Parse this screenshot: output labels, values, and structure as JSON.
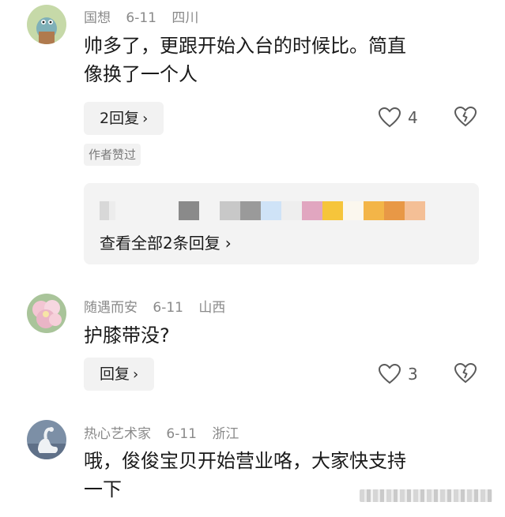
{
  "comments": [
    {
      "user": "国想",
      "date": "6-11",
      "location": "四川",
      "text_line1": "帅多了，更跟开始入台的时候比。简直",
      "text_line2": "像换了一个人",
      "reply_label": "2回复",
      "likes": "4",
      "author_badge": "作者赞过",
      "view_all_replies": "查看全部2条回复"
    },
    {
      "user": "随遇而安",
      "date": "6-11",
      "location": "山西",
      "text_line1": "护膝带没?",
      "reply_label": "回复",
      "likes": "3"
    },
    {
      "user": "热心艺术家",
      "date": "6-11",
      "location": "浙江",
      "text_line1": "哦，俊俊宝贝开始营业咯，大家快支持",
      "text_line2": "一下"
    }
  ],
  "icons": {
    "chevron": "›",
    "heart": "heart-outline-icon",
    "dislike": "broken-heart-icon"
  },
  "colors": {
    "meta_text": "#8a8a8a",
    "button_bg": "#f2f2f2",
    "panel_bg": "#f3f3f3",
    "icon_stroke": "#5a5a5a"
  }
}
